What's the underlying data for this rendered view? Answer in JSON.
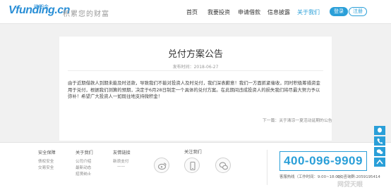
{
  "header": {
    "logo_text": "Vfunding.cn",
    "logo_sub": "微积金",
    "slogan": "积累您的财富",
    "nav": [
      "首页",
      "我要投资",
      "申请借款",
      "信息披露",
      "关于我们"
    ],
    "login": "登录",
    "register": "注册",
    "accent": "#2a9fd8"
  },
  "article": {
    "title": "兑付方案公告",
    "meta": "发布时间：2018-06-27",
    "body": "由于近期借款人到期未能及时还款，导致我们不能对投资人及时兑付，我们深表歉意！我们一方面抓紧催收，同时积极筹措资金用于兑付，根据我们测算的预期，决定于6月28日制定一个具体的兑付方案。在此期间违成投资人的损失我们将尽最大努力予以弥补！希望广大投资人一如既往地支持微积金！",
    "next": "下一篇：关于清凉一夏活动延期的公告"
  },
  "footer": {
    "cols": [
      {
        "title": "安全保障",
        "items": [
          "债权安全",
          "交易安全"
        ]
      },
      {
        "title": "关于我们",
        "items": [
          "公司介绍",
          "最新动态",
          "招贤纳士"
        ]
      },
      {
        "title": "友情链接",
        "items": [
          "新浪支付",
          "——"
        ]
      }
    ],
    "follow": "关注我们",
    "social_icons": [
      "weibo-icon",
      "mobile-app-icon",
      "wechat-icon"
    ],
    "phone": "400-096-9909",
    "hotline": "客服热线（工作时间：9:00~18:00）",
    "qq": "QQ咨询群:2059195414"
  },
  "float_icons": [
    "qq-icon",
    "phone-icon",
    "wechat-icon",
    "top-icon"
  ],
  "watermark": "网贷天眼"
}
